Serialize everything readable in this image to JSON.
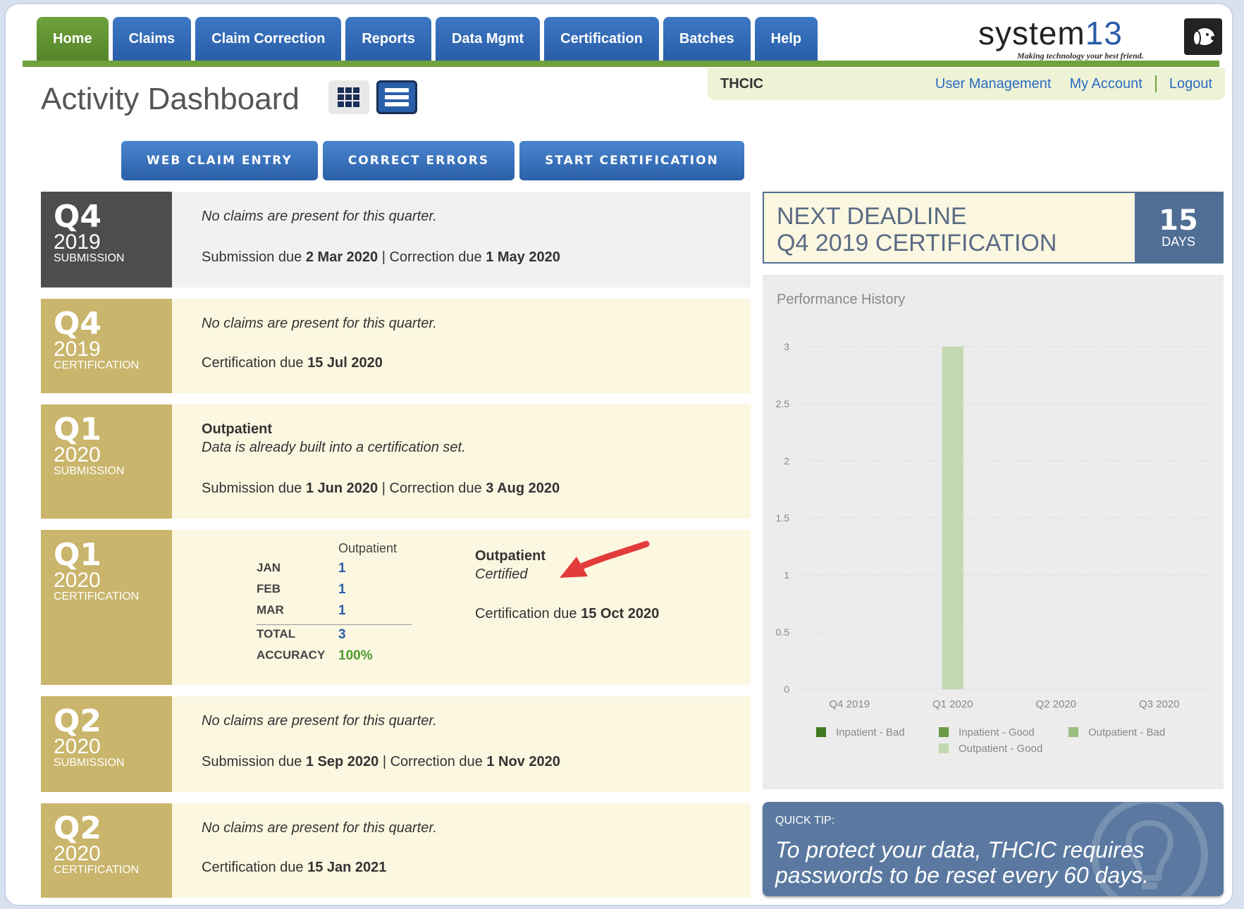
{
  "nav": {
    "tabs": [
      {
        "label": "Home",
        "active": true
      },
      {
        "label": "Claims"
      },
      {
        "label": "Claim Correction"
      },
      {
        "label": "Reports"
      },
      {
        "label": "Data Mgmt"
      },
      {
        "label": "Certification"
      },
      {
        "label": "Batches"
      },
      {
        "label": "Help"
      }
    ]
  },
  "logo": {
    "word_a": "system",
    "word_b": "13",
    "tagline": "Making technology your best friend."
  },
  "userbar": {
    "org": "THCIC",
    "user_management": "User Management",
    "my_account": "My Account",
    "logout": "Logout"
  },
  "page": {
    "title": "Activity Dashboard"
  },
  "actions": {
    "web_claim_entry": "WEB CLAIM ENTRY",
    "correct_errors": "CORRECT ERRORS",
    "start_certification": "START CERTIFICATION"
  },
  "rows": [
    {
      "q": "Q4",
      "year": "2019",
      "kind": "SUBMISSION",
      "note": "No claims are present for this quarter.",
      "due_a_label": "Submission due ",
      "due_a": "2 Mar 2020",
      "due_b_label": " | Correction due ",
      "due_b": "1 May 2020"
    },
    {
      "q": "Q4",
      "year": "2019",
      "kind": "CERTIFICATION",
      "note": "No claims are present for this quarter.",
      "due_a_label": "Certification due ",
      "due_a": "15 Jul 2020"
    },
    {
      "q": "Q1",
      "year": "2020",
      "kind": "SUBMISSION",
      "heading": "Outpatient",
      "note": "Data is already built into a certification set.",
      "due_a_label": "Submission due ",
      "due_a": "1 Jun 2020",
      "due_b_label": " | Correction due ",
      "due_b": "3 Aug 2020"
    },
    {
      "q": "Q1",
      "year": "2020",
      "kind": "CERTIFICATION",
      "table": {
        "header": "Outpatient",
        "months": [
          {
            "k": "JAN",
            "v": "1"
          },
          {
            "k": "FEB",
            "v": "1"
          },
          {
            "k": "MAR",
            "v": "1"
          }
        ],
        "total_label": "TOTAL",
        "total": "3",
        "accuracy_label": "ACCURACY",
        "accuracy": "100%"
      },
      "heading": "Outpatient",
      "status": "Certified",
      "due_a_label": "Certification due ",
      "due_a": "15 Oct 2020"
    },
    {
      "q": "Q2",
      "year": "2020",
      "kind": "SUBMISSION",
      "note": "No claims are present for this quarter.",
      "due_a_label": "Submission due ",
      "due_a": "1 Sep 2020",
      "due_b_label": " | Correction due ",
      "due_b": "1 Nov 2020"
    },
    {
      "q": "Q2",
      "year": "2020",
      "kind": "CERTIFICATION",
      "note": "No claims are present for this quarter.",
      "due_a_label": "Certification due ",
      "due_a": "15 Jan 2021"
    }
  ],
  "deadline": {
    "line1": "NEXT DEADLINE",
    "line2": "Q4 2019 CERTIFICATION",
    "days": "15",
    "days_unit": "DAYS"
  },
  "performance": {
    "title": "Performance History"
  },
  "chart_data": {
    "type": "bar",
    "title": "Performance History",
    "categories": [
      "Q4 2019",
      "Q1 2020",
      "Q2 2020",
      "Q3 2020"
    ],
    "series": [
      {
        "name": "Inpatient - Bad",
        "color": "#3f7a1f",
        "values": [
          0,
          0,
          0,
          0
        ]
      },
      {
        "name": "Inpatient - Good",
        "color": "#6a9a45",
        "values": [
          0,
          0,
          0,
          0
        ]
      },
      {
        "name": "Outpatient - Bad",
        "color": "#9bbd7e",
        "values": [
          0,
          0,
          0,
          0
        ]
      },
      {
        "name": "Outpatient - Good",
        "color": "#c3d8b0",
        "values": [
          0,
          3,
          0,
          0
        ]
      }
    ],
    "ylim": [
      0,
      3
    ],
    "yticks": [
      "0",
      "0.5",
      "1",
      "1.5",
      "2",
      "2.5",
      "3"
    ],
    "grid": true,
    "legend": "bottom"
  },
  "tip": {
    "label": "QUICK TIP:",
    "message": "To protect your data, THCIC requires passwords to be reset every 60 days."
  },
  "colors": {
    "nav_blue": "#2a5ea8",
    "nav_green": "#6fa23c",
    "gold": "#c9b56b",
    "dark": "#4d4d4d",
    "accuracy": "#4e9a2e"
  },
  "icons": {
    "grid_view": "grid-view-icon",
    "list_view": "list-view-icon",
    "arrow": "annotation-arrow-icon",
    "bulb": "lightbulb-icon"
  }
}
